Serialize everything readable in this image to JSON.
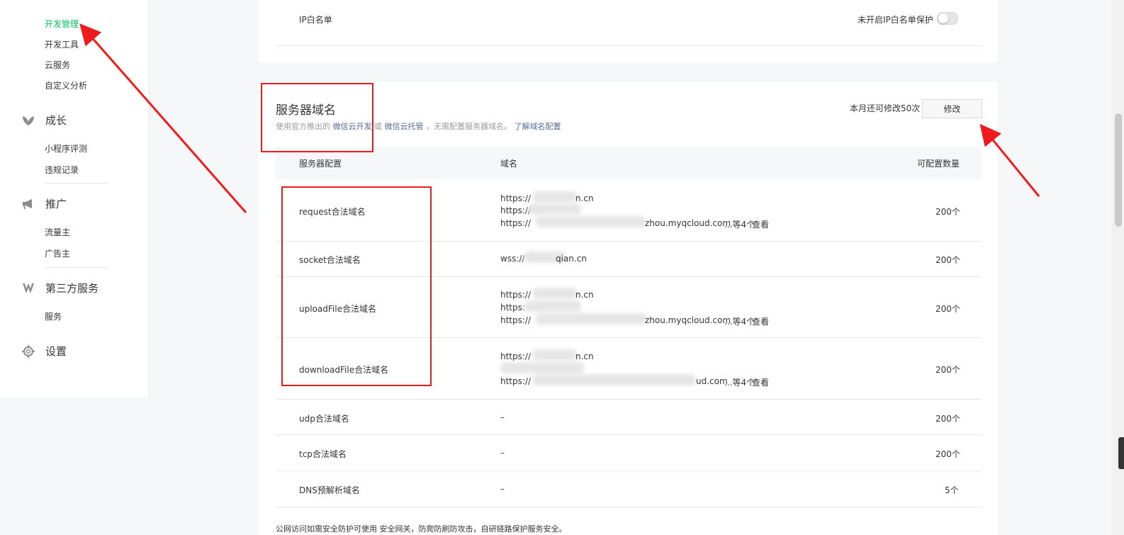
{
  "sidebar": {
    "dev_items": [
      "开发管理",
      "开发工具",
      "云服务",
      "自定义分析"
    ],
    "grow": {
      "label": "成长",
      "icon": "leaf-icon",
      "items": [
        "小程序评测",
        "违规记录"
      ]
    },
    "promote": {
      "label": "推广",
      "icon": "megaphone-icon",
      "items": [
        "流量主",
        "广告主"
      ]
    },
    "third": {
      "label": "第三方服务",
      "icon": "third-party-icon",
      "items": [
        "服务"
      ]
    },
    "settings": {
      "label": "设置",
      "icon": "gear-icon"
    }
  },
  "ip_whitelist": {
    "label": "IP白名单",
    "status": "未开启IP白名单保护"
  },
  "server_domain": {
    "title": "服务器域名",
    "desc_prefix": "使用官方推出的",
    "link1": "微信云开发",
    "or": "或",
    "link2": "微信云托管",
    "desc_mid": "，无需配置服务器域名。",
    "learn": "了解域名配置",
    "remaining": "本月还可修改50次",
    "modify_button": "修改",
    "headers": [
      "服务器配置",
      "域名",
      "可配置数量"
    ],
    "rows": [
      {
        "name": "request合法域名",
        "lines": [
          "https://",
          "https://",
          "https://"
        ],
        "more": "...等4个",
        "view": "查看",
        "count": "200个",
        "suffix": [
          "n.cn",
          "",
          "zhou.myqcloud.com"
        ]
      },
      {
        "name": "socket合法域名",
        "lines": [
          "wss://"
        ],
        "suffix": [
          "qian.cn"
        ],
        "count": "200个"
      },
      {
        "name": "uploadFile合法域名",
        "lines": [
          "https://",
          "https:",
          "https://"
        ],
        "more": "...等4个",
        "view": "查看",
        "count": "200个",
        "suffix": [
          "n.cn",
          "",
          "zhou.myqcloud.com"
        ]
      },
      {
        "name": "downloadFile合法域名",
        "lines": [
          "https://",
          "",
          "https://"
        ],
        "more": "...等4个",
        "view": "查看",
        "count": "200个",
        "suffix": [
          "n.cn",
          "",
          "ud.com"
        ]
      },
      {
        "name": "udp合法域名",
        "value": "–",
        "count": "200个"
      },
      {
        "name": "tcp合法域名",
        "value": "–",
        "count": "200个"
      },
      {
        "name": "DNS预解析域名",
        "value": "–",
        "count": "5个"
      }
    ],
    "footer": "公网访问如需安全防护可使用 安全网关，防爬防刷防攻击，自研链路保护服务安全。"
  }
}
